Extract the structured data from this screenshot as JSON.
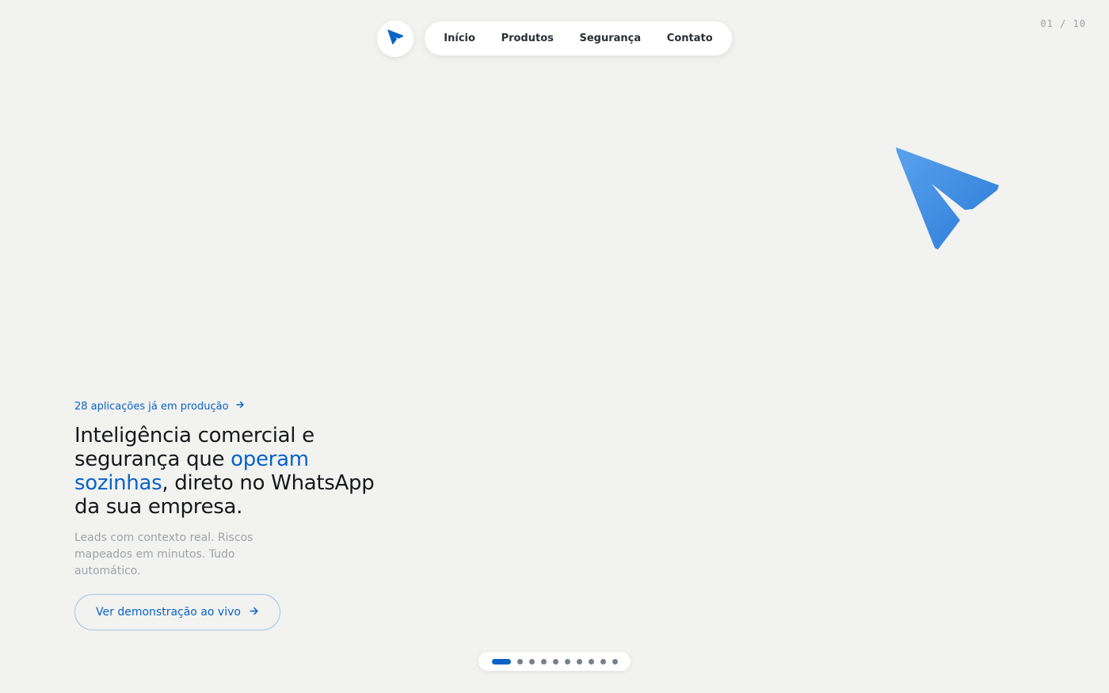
{
  "nav": {
    "logo_icon": "paper-plane-icon",
    "links": [
      "Início",
      "Produtos",
      "Segurança",
      "Contato"
    ]
  },
  "slide_counter": "01 / 10",
  "hero": {
    "logo_icon": "paper-plane-icon",
    "tagline": "28 aplicações já em produção",
    "headline_part1": "Inteligência comercial e segurança que ",
    "headline_accent": "operam sozinhas",
    "headline_part2": ", direto no WhatsApp da sua empresa.",
    "subtext": "Leads com contexto real. Riscos mapeados em minutos. Tudo automático.",
    "cta_label": "Ver demonstração ao vivo"
  },
  "pagination": {
    "total": 10,
    "current": 1
  },
  "colors": {
    "accent": "#0a63c5",
    "background": "#f2f2f0",
    "text_dark": "#16181c",
    "text_muted": "#9ea2a8",
    "logo_gradient_start": "#5aa2ec",
    "logo_gradient_end": "#2a7ad8"
  }
}
